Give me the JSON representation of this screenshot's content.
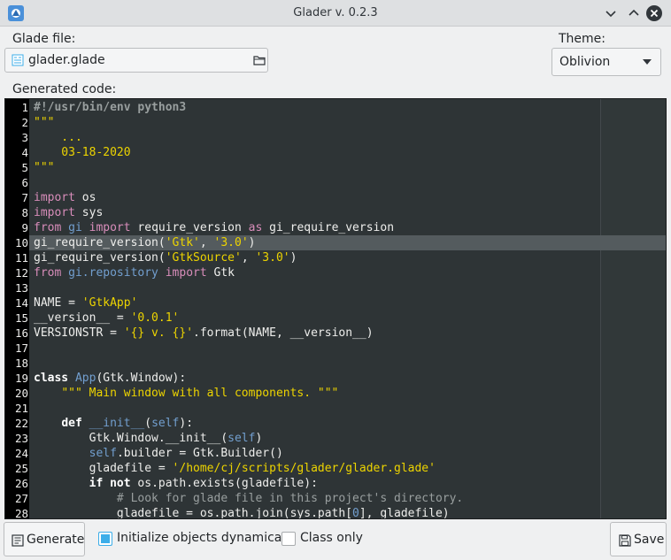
{
  "window": {
    "title": "Glader v. 0.2.3",
    "accent": "#3daee9"
  },
  "glade_file": {
    "label": "Glade file:",
    "value": "glader.glade",
    "icon": "document-icon",
    "browse_icon": "folder-icon"
  },
  "theme": {
    "label": "Theme:",
    "selected": "Oblivion"
  },
  "code_section": {
    "label": "Generated code:",
    "highlighted_line": 10,
    "lines": [
      {
        "n": "1",
        "t": [
          [
            "preproc",
            "#!/usr/bin/env python3"
          ]
        ]
      },
      {
        "n": "2",
        "t": [
          [
            "string",
            "\"\"\""
          ]
        ]
      },
      {
        "n": "3",
        "t": [
          [
            "string",
            "    ..."
          ]
        ]
      },
      {
        "n": "4",
        "t": [
          [
            "string",
            "    03-18-2020"
          ]
        ]
      },
      {
        "n": "5",
        "t": [
          [
            "string",
            "\"\"\""
          ]
        ]
      },
      {
        "n": "6",
        "t": []
      },
      {
        "n": "7",
        "t": [
          [
            "keyword",
            "import"
          ],
          [
            "plain",
            " os"
          ]
        ]
      },
      {
        "n": "8",
        "t": [
          [
            "keyword",
            "import"
          ],
          [
            "plain",
            " sys"
          ]
        ]
      },
      {
        "n": "9",
        "t": [
          [
            "keyword",
            "from"
          ],
          [
            "plain",
            " "
          ],
          [
            "func",
            "gi"
          ],
          [
            "plain",
            " "
          ],
          [
            "keyword",
            "import"
          ],
          [
            "plain",
            " require_version "
          ],
          [
            "keyword",
            "as"
          ],
          [
            "plain",
            " gi_require_version"
          ]
        ]
      },
      {
        "n": "10",
        "t": [
          [
            "plain",
            "gi_require_version("
          ],
          [
            "string",
            "'Gtk'"
          ],
          [
            "plain",
            ", "
          ],
          [
            "string",
            "'3.0'"
          ],
          [
            "plain",
            ")"
          ]
        ]
      },
      {
        "n": "11",
        "t": [
          [
            "plain",
            "gi_require_version("
          ],
          [
            "string",
            "'GtkSource'"
          ],
          [
            "plain",
            ", "
          ],
          [
            "string",
            "'3.0'"
          ],
          [
            "plain",
            ")"
          ]
        ]
      },
      {
        "n": "12",
        "t": [
          [
            "keyword",
            "from"
          ],
          [
            "plain",
            " "
          ],
          [
            "func",
            "gi.repository"
          ],
          [
            "plain",
            " "
          ],
          [
            "keyword",
            "import"
          ],
          [
            "plain",
            " Gtk"
          ]
        ]
      },
      {
        "n": "13",
        "t": []
      },
      {
        "n": "14",
        "t": [
          [
            "plain",
            "NAME = "
          ],
          [
            "string",
            "'GtkApp'"
          ]
        ]
      },
      {
        "n": "15",
        "t": [
          [
            "plain",
            "__version__ = "
          ],
          [
            "string",
            "'0.0.1'"
          ]
        ]
      },
      {
        "n": "16",
        "t": [
          [
            "plain",
            "VERSIONSTR = "
          ],
          [
            "string",
            "'{} v. {}'"
          ],
          [
            "plain",
            ".format(NAME, __version__)"
          ]
        ]
      },
      {
        "n": "17",
        "t": []
      },
      {
        "n": "18",
        "t": []
      },
      {
        "n": "19",
        "t": [
          [
            "bold",
            "class"
          ],
          [
            "plain",
            " "
          ],
          [
            "func",
            "App"
          ],
          [
            "plain",
            "(Gtk.Window):"
          ]
        ]
      },
      {
        "n": "20",
        "t": [
          [
            "plain",
            "    "
          ],
          [
            "string",
            "\"\"\" Main window with all components. \"\"\""
          ]
        ]
      },
      {
        "n": "21",
        "t": []
      },
      {
        "n": "22",
        "t": [
          [
            "plain",
            "    "
          ],
          [
            "bold",
            "def"
          ],
          [
            "plain",
            " "
          ],
          [
            "func",
            "__init__"
          ],
          [
            "plain",
            "("
          ],
          [
            "func",
            "self"
          ],
          [
            "plain",
            "):"
          ]
        ]
      },
      {
        "n": "23",
        "t": [
          [
            "plain",
            "        Gtk.Window.__init__("
          ],
          [
            "func",
            "self"
          ],
          [
            "plain",
            ")"
          ]
        ]
      },
      {
        "n": "24",
        "t": [
          [
            "plain",
            "        "
          ],
          [
            "func",
            "self"
          ],
          [
            "plain",
            ".builder = Gtk.Builder()"
          ]
        ]
      },
      {
        "n": "25",
        "t": [
          [
            "plain",
            "        gladefile = "
          ],
          [
            "string",
            "'/home/cj/scripts/glader/glader.glade'"
          ]
        ]
      },
      {
        "n": "26",
        "t": [
          [
            "plain",
            "        "
          ],
          [
            "bold",
            "if"
          ],
          [
            "plain",
            " "
          ],
          [
            "bold",
            "not"
          ],
          [
            "plain",
            " os.path.exists(gladefile):"
          ]
        ]
      },
      {
        "n": "27",
        "t": [
          [
            "comment",
            "            # Look for glade file in this project's directory."
          ]
        ]
      },
      {
        "n": "28",
        "t": [
          [
            "plain",
            "            gladefile = os.path.join(sys.path["
          ],
          [
            "func",
            "0"
          ],
          [
            "plain",
            "], gladefile)"
          ]
        ]
      }
    ]
  },
  "bottom": {
    "generate_label": "Generate",
    "init_dynamic_label": "Initialize objects dynamically",
    "init_dynamic_checked": true,
    "class_only_label": "Class only",
    "class_only_checked": false,
    "save_label": "Save"
  }
}
